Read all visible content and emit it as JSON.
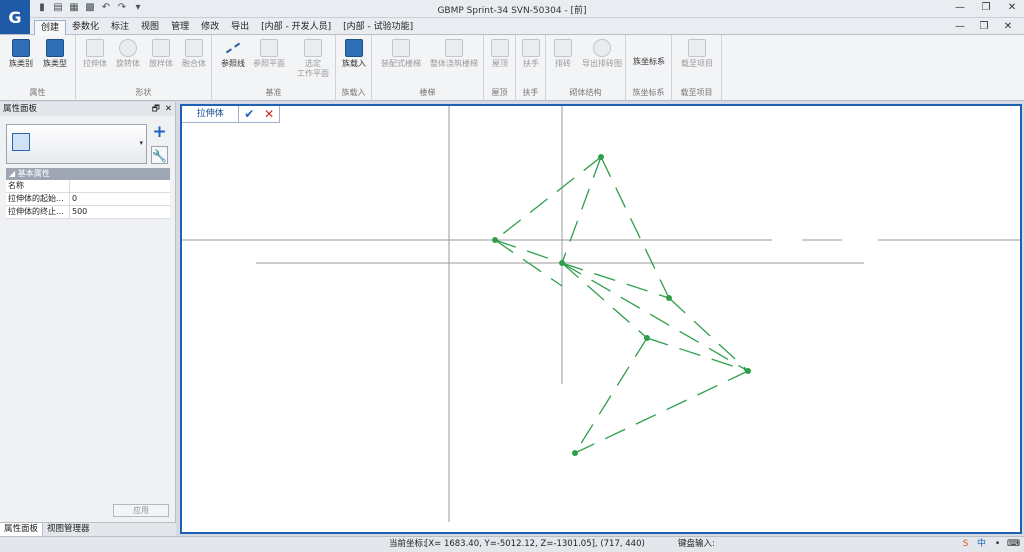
{
  "window": {
    "title": "GBMP Sprint-34 SVN-50304 - [前]",
    "quick_access": [
      "▮",
      "▤",
      "▦",
      "▩",
      "↶",
      "↷",
      "▾"
    ],
    "controls": [
      "—",
      "❐",
      "✕"
    ]
  },
  "menu": {
    "tabs": [
      "创建",
      "参数化",
      "标注",
      "视图",
      "管理",
      "修改",
      "导出",
      "[内部 - 开发人员]",
      "[内部 - 试验功能]"
    ],
    "active_tab": "创建",
    "right_controls": [
      "—",
      "❐",
      "✕"
    ]
  },
  "ribbon": {
    "groups": [
      {
        "label": "属性",
        "buttons": [
          "族类别",
          "族类型"
        ]
      },
      {
        "label": "形状",
        "buttons": [
          "拉伸体",
          "旋转体",
          "放样体",
          "融合体"
        ]
      },
      {
        "label": "基准",
        "buttons": [
          "参照线",
          "参照平面",
          "选定\n工作平面"
        ]
      },
      {
        "label": "族载入",
        "buttons": [
          "族载入"
        ]
      },
      {
        "label": "楼梯",
        "buttons": [
          "装配式楼梯",
          "整体浇筑楼梯"
        ]
      },
      {
        "label": "屋顶",
        "buttons": [
          "屋顶"
        ]
      },
      {
        "label": "扶手",
        "buttons": [
          "扶手"
        ]
      },
      {
        "label": "砌体结构",
        "buttons": [
          "排砖",
          "导出排砖图"
        ]
      },
      {
        "label": "族坐标系",
        "buttons": [
          "族坐标系"
        ]
      },
      {
        "label": "载至项目",
        "buttons": [
          "载至项目"
        ]
      }
    ]
  },
  "properties_panel": {
    "title": "属性面板",
    "header_buttons": [
      "🗗",
      "✕"
    ],
    "add_type_icon": "+",
    "edit_type_icon": "🔧",
    "dropdown_icon": "▾",
    "section_title": "基本属性",
    "section_toggle": "◢",
    "rows": [
      {
        "name": "名称",
        "value": ""
      },
      {
        "name": "拉伸体的起始...",
        "value": "0"
      },
      {
        "name": "拉伸体的终止...",
        "value": "500"
      }
    ],
    "apply_label": "应用"
  },
  "panel_tabs": [
    "属性面板",
    "视图管理器"
  ],
  "sketch_toolbar": {
    "label": "拉伸体",
    "confirm_icon": "✔",
    "cancel_icon": "✕"
  },
  "status_bar": {
    "coord_label": "当前坐标:",
    "coord_value": "[X= 1683.40, Y=-5012.12, Z=-1301.05], (717, 440)",
    "keyboard_label": "键盘输入:",
    "tray": [
      "S",
      "中",
      "•",
      "⌨"
    ]
  },
  "colors": {
    "sketch_line": "#2e9e4b",
    "sketch_vertex": "#2e9e4b",
    "accent": "#1f62b3",
    "ref_plane": "#9a9a9a"
  }
}
